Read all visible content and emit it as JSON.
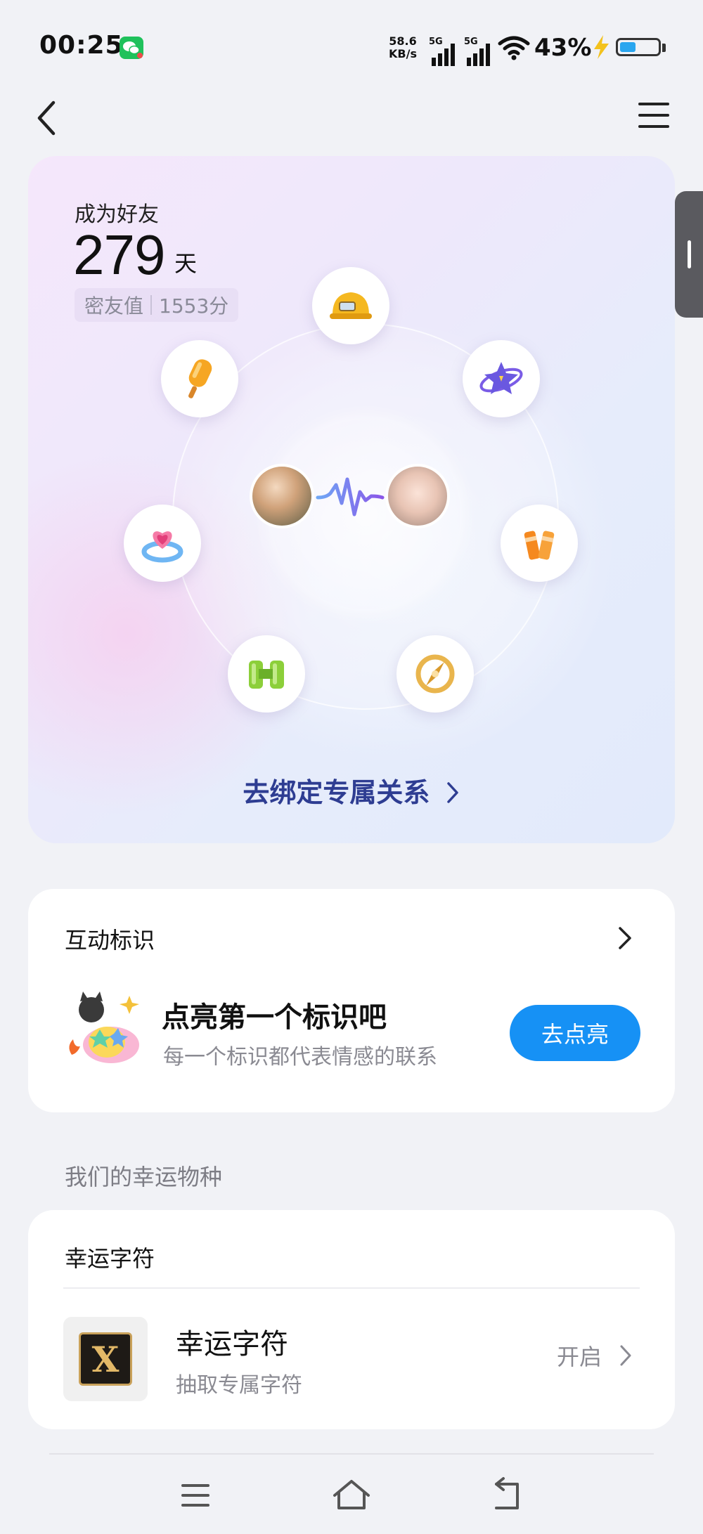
{
  "status_bar": {
    "time": "00:25",
    "net_speed_value": "58.6",
    "net_speed_unit": "KB/s",
    "signal1_label": "5G",
    "signal2_label": "5G",
    "battery_percent": "43%",
    "battery_level": 0.43,
    "app_icon": "wechat-icon"
  },
  "nav": {
    "back_icon": "back-chevron-icon",
    "menu_icon": "menu-icon"
  },
  "friendship": {
    "label": "成为好友",
    "days": "279",
    "days_unit": "天",
    "intimacy_label": "密友值",
    "intimacy_value": "1553分",
    "badges": [
      "helmet-icon",
      "popsicle-icon",
      "star-planet-icon",
      "heart-ring-icon",
      "crayons-icon",
      "binoculars-icon",
      "compass-icon"
    ],
    "bind_link": "去绑定专属关系"
  },
  "interaction": {
    "title": "互动标识",
    "headline": "点亮第一个标识吧",
    "subtitle": "每一个标识都代表情感的联系",
    "button": "去点亮"
  },
  "lucky": {
    "section_label": "我们的幸运物种",
    "card_title": "幸运字符",
    "item_title": "幸运字符",
    "item_subtitle": "抽取专属字符",
    "action": "开启",
    "thumb_letter": "X"
  },
  "colors": {
    "accent_blue": "#1691f5",
    "link_navy": "#2e3d92",
    "page_bg": "#f1f2f6"
  }
}
